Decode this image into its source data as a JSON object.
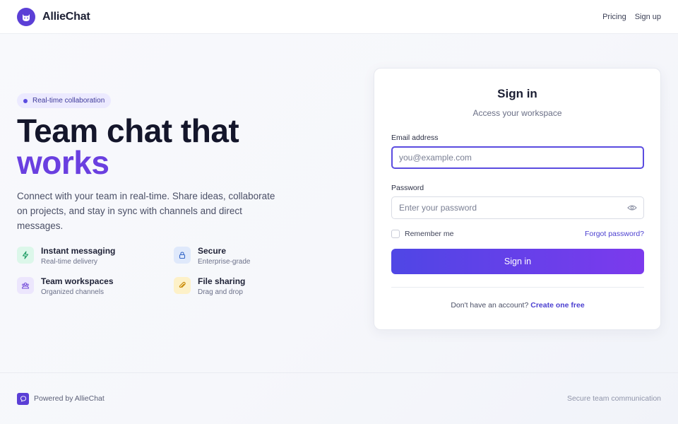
{
  "header": {
    "brand_name": "AllieChat",
    "logo_icon": "cat-face-icon",
    "nav": [
      "Pricing",
      "Sign up"
    ]
  },
  "hero": {
    "badge": "Real-time collaboration",
    "title_line1": "Team chat that",
    "title_line2": "works",
    "description": "Connect with your team in real-time. Share ideas, collaborate on projects, and stay in sync with channels and direct messages.",
    "features": [
      {
        "title": "Instant messaging",
        "subtitle": "Real-time delivery",
        "icon": "lightning-icon"
      },
      {
        "title": "Secure",
        "subtitle": "Enterprise-grade",
        "icon": "lock-icon"
      },
      {
        "title": "Team workspaces",
        "subtitle": "Organized channels",
        "icon": "team-icon"
      },
      {
        "title": "File sharing",
        "subtitle": "Drag and drop",
        "icon": "paperclip-icon"
      }
    ]
  },
  "signin": {
    "title": "Sign in",
    "subtitle": "Access your workspace",
    "email_label": "Email address",
    "email_placeholder": "you@example.com",
    "email_value": "",
    "password_label": "Password",
    "password_placeholder": "Enter your password",
    "password_value": "",
    "remember_label": "Remember me",
    "remember_checked": false,
    "forgot_label": "Forgot password?",
    "submit_label": "Sign in",
    "signup_prompt": "Don't have an account?",
    "signup_link": "Create one free"
  },
  "footer": {
    "powered_by": "Powered by AllieChat",
    "tagline": "Secure team communication"
  },
  "colors": {
    "brand": "#5b3fd6",
    "accent_text": "#6a3fe0",
    "link": "#4b3fd0",
    "button_gradient_start": "#4f46e5",
    "button_gradient_end": "#7c3aed"
  }
}
